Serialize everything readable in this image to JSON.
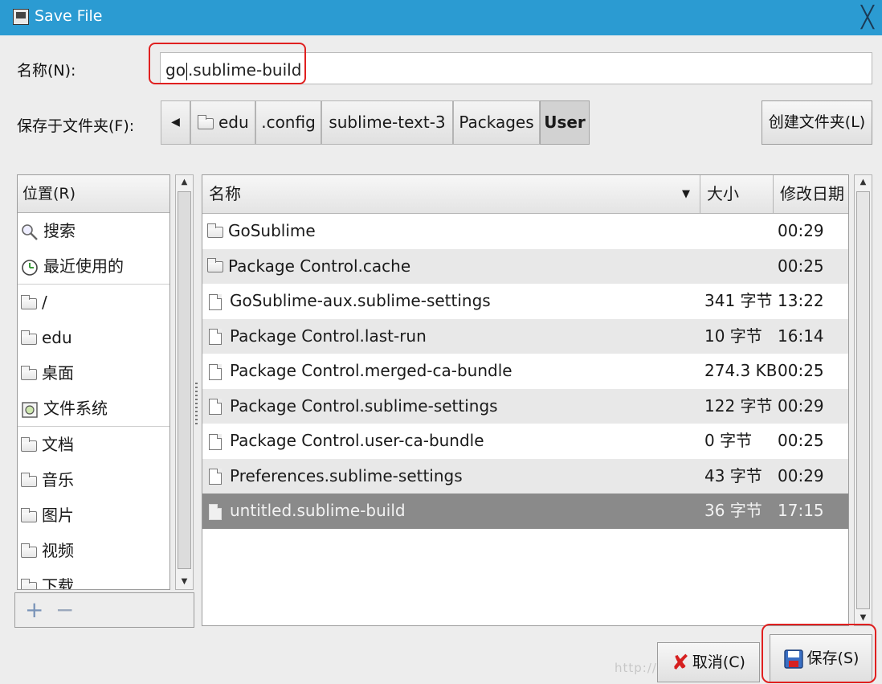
{
  "window": {
    "title": "Save File",
    "close_label": "╳"
  },
  "name_field": {
    "label": "名称(N):",
    "value_before_caret": "go",
    "value_after_caret": ".sublime-build"
  },
  "folder": {
    "label": "保存于文件夹(F):",
    "back_label": "◀",
    "breadcrumb": [
      "edu",
      ".config",
      "sublime-text-3",
      "Packages",
      "User"
    ],
    "create_folder_label": "创建文件夹(L)"
  },
  "places": {
    "header": "位置(R)",
    "items": [
      {
        "label": "搜索",
        "icon": "search-icon"
      },
      {
        "label": "最近使用的",
        "icon": "recent-icon"
      },
      {
        "label": "/",
        "icon": "folder-icon"
      },
      {
        "label": "edu",
        "icon": "folder-icon"
      },
      {
        "label": "桌面",
        "icon": "folder-icon"
      },
      {
        "label": "文件系统",
        "icon": "drive-icon"
      },
      {
        "label": "文档",
        "icon": "folder-icon"
      },
      {
        "label": "音乐",
        "icon": "folder-icon"
      },
      {
        "label": "图片",
        "icon": "folder-icon"
      },
      {
        "label": "视频",
        "icon": "folder-icon"
      },
      {
        "label": "下载",
        "icon": "folder-icon"
      }
    ],
    "add_label": "+",
    "remove_label": "−"
  },
  "files": {
    "columns": {
      "name": "名称",
      "size": "大小",
      "modified": "修改日期"
    },
    "rows": [
      {
        "name": "GoSublime",
        "size": "",
        "modified": "00:29",
        "type": "folder"
      },
      {
        "name": "Package Control.cache",
        "size": "",
        "modified": "00:25",
        "type": "folder"
      },
      {
        "name": "GoSublime-aux.sublime-settings",
        "size": "341 字节",
        "modified": "13:22",
        "type": "file"
      },
      {
        "name": "Package Control.last-run",
        "size": "10 字节",
        "modified": "16:14",
        "type": "file"
      },
      {
        "name": "Package Control.merged-ca-bundle",
        "size": "274.3 KB",
        "modified": "00:25",
        "type": "file"
      },
      {
        "name": "Package Control.sublime-settings",
        "size": "122 字节",
        "modified": "00:29",
        "type": "file"
      },
      {
        "name": "Package Control.user-ca-bundle",
        "size": "0 字节",
        "modified": "00:25",
        "type": "file"
      },
      {
        "name": "Preferences.sublime-settings",
        "size": "43 字节",
        "modified": "00:29",
        "type": "file"
      },
      {
        "name": "untitled.sublime-build",
        "size": "36 字节",
        "modified": "17:15",
        "type": "file"
      }
    ]
  },
  "buttons": {
    "cancel": "取消(C)",
    "save": "保存(S)"
  },
  "watermark": "http://",
  "colors": {
    "titlebar": "#2b9bd2",
    "selected_row": "#8a8a8a",
    "highlight_outline": "#e02020"
  }
}
